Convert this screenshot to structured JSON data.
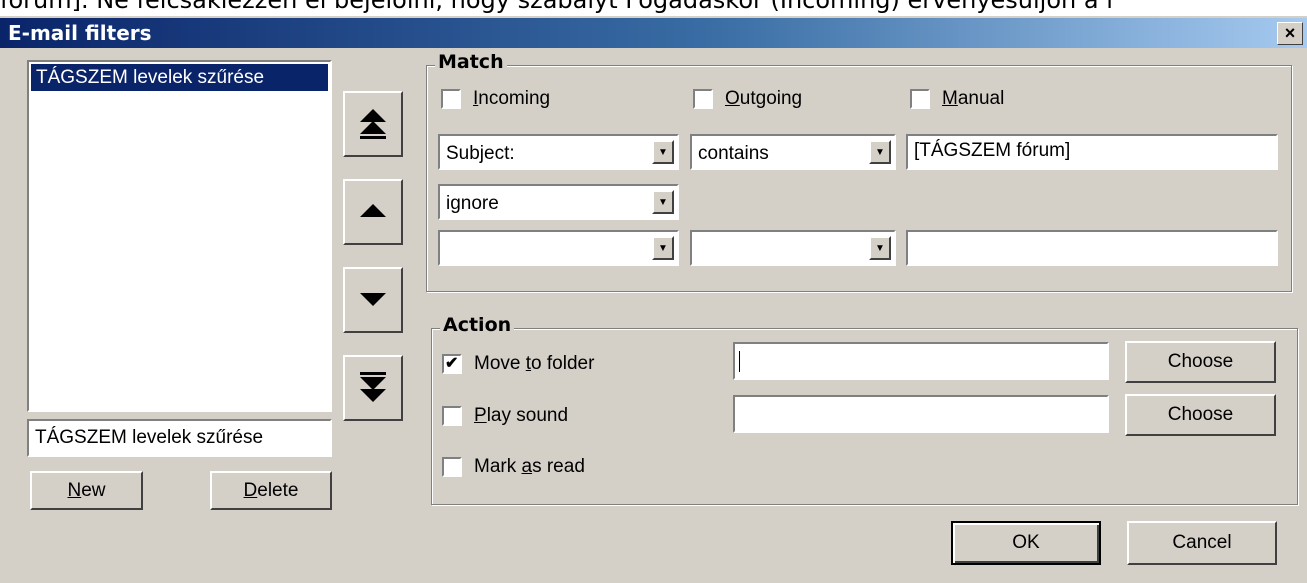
{
  "top_text": "fórum]. Ne felcsaklezzen el bejelölni, hogy szabályt Fogadáskor (Incoming) érvényesüljön a l",
  "window": {
    "title": "E-mail filters",
    "close_label": "×"
  },
  "filter_list": {
    "items": [
      "TÁGSZEM levelek szűrése"
    ],
    "selected_index": 0,
    "name_value": "TÁGSZEM levelek szűrése"
  },
  "buttons": {
    "new": {
      "pre": "",
      "key": "N",
      "post": "ew"
    },
    "delete": {
      "pre": "",
      "key": "D",
      "post": "elete"
    },
    "ok": "OK",
    "cancel": "Cancel"
  },
  "reorder": {
    "top_icon": "move-to-top-icon",
    "up_icon": "move-up-icon",
    "down_icon": "move-down-icon",
    "bottom_icon": "move-to-bottom-icon"
  },
  "match": {
    "legend": "Match",
    "incoming": {
      "pre": "",
      "key": "I",
      "post": "ncoming",
      "checked": false
    },
    "outgoing": {
      "pre": "",
      "key": "O",
      "post": "utgoing",
      "checked": false
    },
    "manual": {
      "pre": "",
      "key": "M",
      "post": "anual",
      "checked": false
    },
    "row1": {
      "field": "Subject:",
      "condition": "contains",
      "value": "[TÁGSZEM fórum]"
    },
    "row_op": "ignore",
    "row2": {
      "field": "",
      "condition": "",
      "value": ""
    }
  },
  "action": {
    "legend": "Action",
    "move": {
      "pre": "Move ",
      "key": "t",
      "post": "o folder",
      "checked": true,
      "value": ""
    },
    "sound": {
      "pre": "",
      "key": "P",
      "post": "lay sound",
      "checked": false,
      "value": ""
    },
    "mark": {
      "pre": "Mark ",
      "key": "a",
      "post": "s read",
      "checked": false
    },
    "choose_label": "Choose"
  }
}
